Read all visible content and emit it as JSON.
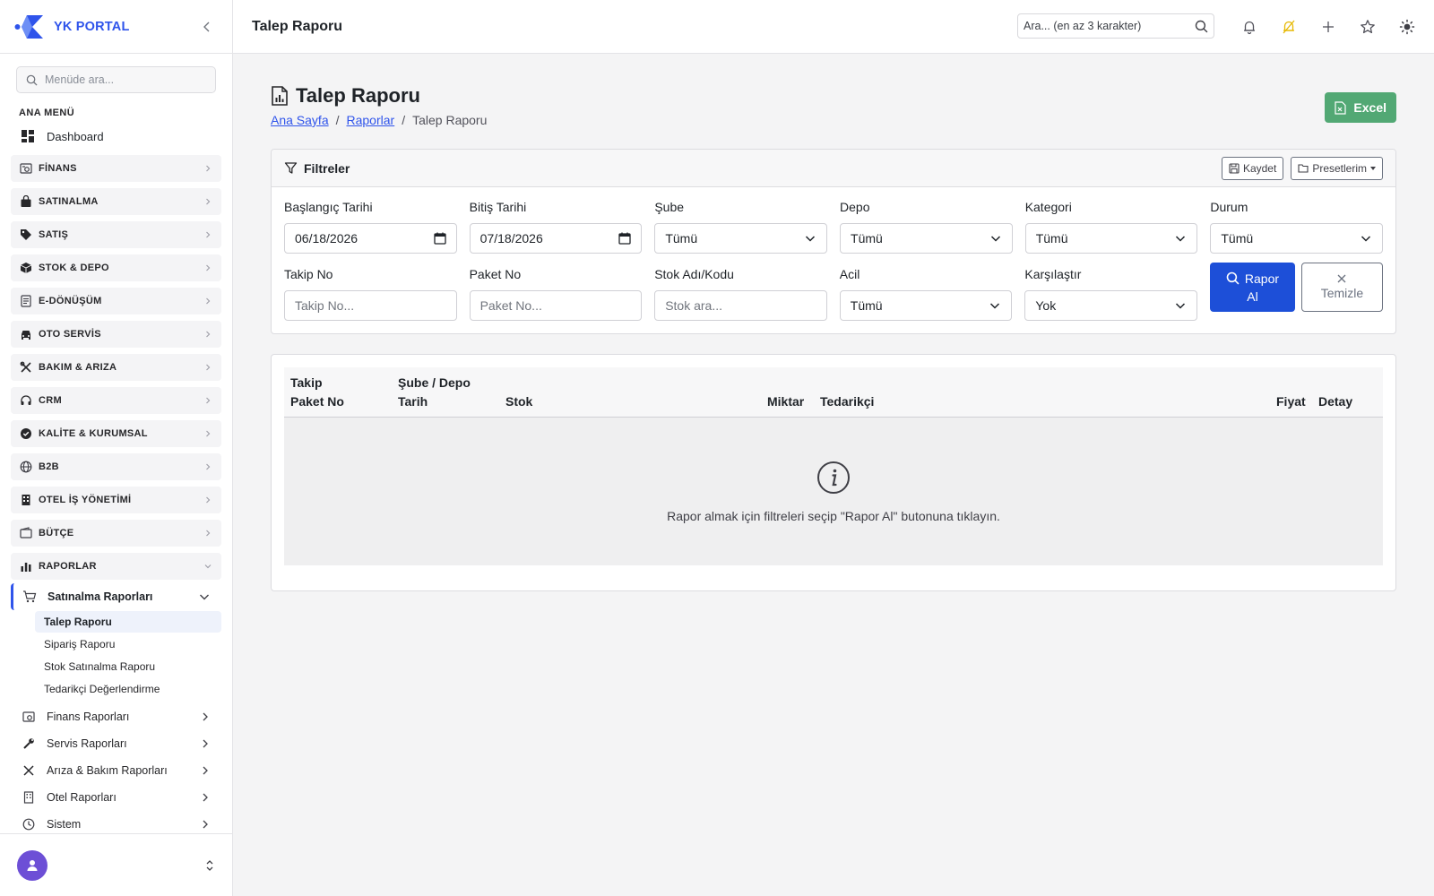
{
  "brand": {
    "name": "YK PORTAL"
  },
  "sidebar": {
    "search_placeholder": "Menüde ara...",
    "section_title": "ANA MENÜ",
    "dashboard": "Dashboard",
    "groups": [
      {
        "label": "FİNANS",
        "icon": "finance-icon"
      },
      {
        "label": "SATINALMA",
        "icon": "bag-icon"
      },
      {
        "label": "SATIŞ",
        "icon": "tag-icon"
      },
      {
        "label": "STOK & DEPO",
        "icon": "box-icon"
      },
      {
        "label": "E-DÖNÜŞÜM",
        "icon": "document-icon"
      },
      {
        "label": "OTO SERVİS",
        "icon": "car-icon"
      },
      {
        "label": "BAKIM & ARIZA",
        "icon": "tools-icon"
      },
      {
        "label": "CRM",
        "icon": "headset-icon"
      },
      {
        "label": "KALİTE & KURUMSAL",
        "icon": "badge-icon"
      },
      {
        "label": "B2B",
        "icon": "globe-icon"
      },
      {
        "label": "OTEL İŞ YÖNETİMİ",
        "icon": "building-icon"
      },
      {
        "label": "BÜTÇE",
        "icon": "wallet-icon"
      },
      {
        "label": "RAPORLAR",
        "icon": "bar-chart-icon"
      }
    ],
    "open_submenu": "Satınalma Raporları",
    "leaves": [
      "Talep Raporu",
      "Sipariş Raporu",
      "Stok Satınalma Raporu",
      "Tedarikçi Değerlendirme"
    ],
    "active_leaf": "Talep Raporu",
    "sub_items": [
      "Finans Raporları",
      "Servis Raporları",
      "Arıza & Bakım Raporları",
      "Otel Raporları",
      "Sistem"
    ]
  },
  "topbar": {
    "title": "Talep Raporu",
    "search_placeholder": "Ara... (en az 3 karakter)"
  },
  "page": {
    "title": "Talep Raporu",
    "breadcrumb": [
      "Ana Sayfa",
      "Raporlar",
      "Talep Raporu"
    ],
    "excel_label": "Excel"
  },
  "filters": {
    "title": "Filtreler",
    "save_label": "Kaydet",
    "presets_label": "Presetlerim",
    "start_date_label": "Başlangıç Tarihi",
    "start_date_value": "06/18/2026",
    "end_date_label": "Bitiş Tarihi",
    "end_date_value": "07/18/2026",
    "branch_label": "Şube",
    "branch_value": "Tümü",
    "depot_label": "Depo",
    "depot_value": "Tümü",
    "category_label": "Kategori",
    "category_value": "Tümü",
    "status_label": "Durum",
    "status_value": "Tümü",
    "tracking_label": "Takip No",
    "tracking_placeholder": "Takip No...",
    "package_label": "Paket No",
    "package_placeholder": "Paket No...",
    "stock_label": "Stok Adı/Kodu",
    "stock_placeholder": "Stok ara...",
    "urgent_label": "Acil",
    "urgent_value": "Tümü",
    "compare_label": "Karşılaştır",
    "compare_value": "Yok",
    "report_btn_line1": "Rapor",
    "report_btn_line2": "Al",
    "clear_btn": "Temizle"
  },
  "table": {
    "col1_line1": "Takip",
    "col1_line2": "Paket No",
    "col2_line1": "Şube / Depo",
    "col2_line2": "Tarih",
    "col3": "Stok",
    "col4": "Miktar",
    "col5": "Tedarikçi",
    "col6": "Fiyat",
    "col7": "Detay",
    "empty_message": "Rapor almak için filtreleri seçip \"Rapor Al\" butonuna tıklayın."
  },
  "colors": {
    "brand": "#2f54eb",
    "primary_button": "#1d4fd8",
    "excel_button": "#52a874",
    "avatar": "#6d4fd6",
    "highlight_icon": "#e6b800"
  }
}
